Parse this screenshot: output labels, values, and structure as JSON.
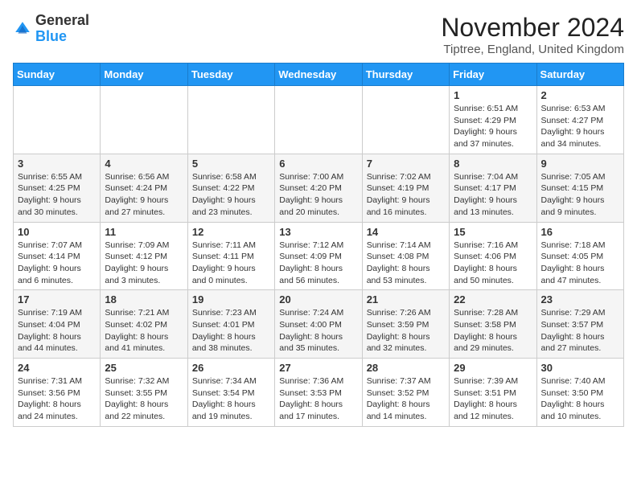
{
  "header": {
    "logo_general": "General",
    "logo_blue": "Blue",
    "month_title": "November 2024",
    "location": "Tiptree, England, United Kingdom"
  },
  "days_of_week": [
    "Sunday",
    "Monday",
    "Tuesday",
    "Wednesday",
    "Thursday",
    "Friday",
    "Saturday"
  ],
  "weeks": [
    [
      {
        "day": "",
        "info": ""
      },
      {
        "day": "",
        "info": ""
      },
      {
        "day": "",
        "info": ""
      },
      {
        "day": "",
        "info": ""
      },
      {
        "day": "",
        "info": ""
      },
      {
        "day": "1",
        "info": "Sunrise: 6:51 AM\nSunset: 4:29 PM\nDaylight: 9 hours and 37 minutes."
      },
      {
        "day": "2",
        "info": "Sunrise: 6:53 AM\nSunset: 4:27 PM\nDaylight: 9 hours and 34 minutes."
      }
    ],
    [
      {
        "day": "3",
        "info": "Sunrise: 6:55 AM\nSunset: 4:25 PM\nDaylight: 9 hours and 30 minutes."
      },
      {
        "day": "4",
        "info": "Sunrise: 6:56 AM\nSunset: 4:24 PM\nDaylight: 9 hours and 27 minutes."
      },
      {
        "day": "5",
        "info": "Sunrise: 6:58 AM\nSunset: 4:22 PM\nDaylight: 9 hours and 23 minutes."
      },
      {
        "day": "6",
        "info": "Sunrise: 7:00 AM\nSunset: 4:20 PM\nDaylight: 9 hours and 20 minutes."
      },
      {
        "day": "7",
        "info": "Sunrise: 7:02 AM\nSunset: 4:19 PM\nDaylight: 9 hours and 16 minutes."
      },
      {
        "day": "8",
        "info": "Sunrise: 7:04 AM\nSunset: 4:17 PM\nDaylight: 9 hours and 13 minutes."
      },
      {
        "day": "9",
        "info": "Sunrise: 7:05 AM\nSunset: 4:15 PM\nDaylight: 9 hours and 9 minutes."
      }
    ],
    [
      {
        "day": "10",
        "info": "Sunrise: 7:07 AM\nSunset: 4:14 PM\nDaylight: 9 hours and 6 minutes."
      },
      {
        "day": "11",
        "info": "Sunrise: 7:09 AM\nSunset: 4:12 PM\nDaylight: 9 hours and 3 minutes."
      },
      {
        "day": "12",
        "info": "Sunrise: 7:11 AM\nSunset: 4:11 PM\nDaylight: 9 hours and 0 minutes."
      },
      {
        "day": "13",
        "info": "Sunrise: 7:12 AM\nSunset: 4:09 PM\nDaylight: 8 hours and 56 minutes."
      },
      {
        "day": "14",
        "info": "Sunrise: 7:14 AM\nSunset: 4:08 PM\nDaylight: 8 hours and 53 minutes."
      },
      {
        "day": "15",
        "info": "Sunrise: 7:16 AM\nSunset: 4:06 PM\nDaylight: 8 hours and 50 minutes."
      },
      {
        "day": "16",
        "info": "Sunrise: 7:18 AM\nSunset: 4:05 PM\nDaylight: 8 hours and 47 minutes."
      }
    ],
    [
      {
        "day": "17",
        "info": "Sunrise: 7:19 AM\nSunset: 4:04 PM\nDaylight: 8 hours and 44 minutes."
      },
      {
        "day": "18",
        "info": "Sunrise: 7:21 AM\nSunset: 4:02 PM\nDaylight: 8 hours and 41 minutes."
      },
      {
        "day": "19",
        "info": "Sunrise: 7:23 AM\nSunset: 4:01 PM\nDaylight: 8 hours and 38 minutes."
      },
      {
        "day": "20",
        "info": "Sunrise: 7:24 AM\nSunset: 4:00 PM\nDaylight: 8 hours and 35 minutes."
      },
      {
        "day": "21",
        "info": "Sunrise: 7:26 AM\nSunset: 3:59 PM\nDaylight: 8 hours and 32 minutes."
      },
      {
        "day": "22",
        "info": "Sunrise: 7:28 AM\nSunset: 3:58 PM\nDaylight: 8 hours and 29 minutes."
      },
      {
        "day": "23",
        "info": "Sunrise: 7:29 AM\nSunset: 3:57 PM\nDaylight: 8 hours and 27 minutes."
      }
    ],
    [
      {
        "day": "24",
        "info": "Sunrise: 7:31 AM\nSunset: 3:56 PM\nDaylight: 8 hours and 24 minutes."
      },
      {
        "day": "25",
        "info": "Sunrise: 7:32 AM\nSunset: 3:55 PM\nDaylight: 8 hours and 22 minutes."
      },
      {
        "day": "26",
        "info": "Sunrise: 7:34 AM\nSunset: 3:54 PM\nDaylight: 8 hours and 19 minutes."
      },
      {
        "day": "27",
        "info": "Sunrise: 7:36 AM\nSunset: 3:53 PM\nDaylight: 8 hours and 17 minutes."
      },
      {
        "day": "28",
        "info": "Sunrise: 7:37 AM\nSunset: 3:52 PM\nDaylight: 8 hours and 14 minutes."
      },
      {
        "day": "29",
        "info": "Sunrise: 7:39 AM\nSunset: 3:51 PM\nDaylight: 8 hours and 12 minutes."
      },
      {
        "day": "30",
        "info": "Sunrise: 7:40 AM\nSunset: 3:50 PM\nDaylight: 8 hours and 10 minutes."
      }
    ]
  ]
}
